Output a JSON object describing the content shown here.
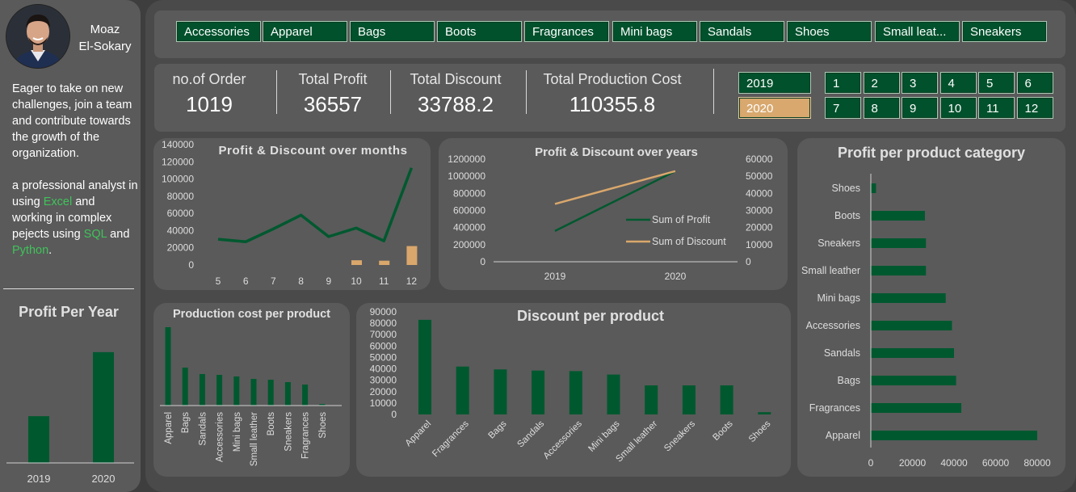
{
  "profile": {
    "name_line1": "Moaz",
    "name_line2": "El-Sokary",
    "about_1": "Eager to take on new challenges, join a team and contribute towards the growth of the organization.",
    "about_2a": "a professional analyst in using ",
    "about_2b": "Excel",
    "about_2c": " and working in complex pejects using ",
    "about_2d": "SQL",
    "about_2e": " and ",
    "about_2f": "Python",
    "about_2g": "."
  },
  "category_slicer": [
    "Accessories",
    "Apparel",
    "Bags",
    "Boots",
    "Fragrances",
    "Mini bags",
    "Sandals",
    "Shoes",
    "Small leat...",
    "Sneakers"
  ],
  "kpis": [
    {
      "label": "no.of Order",
      "value": "1019"
    },
    {
      "label": "Total Profit",
      "value": "36557"
    },
    {
      "label": "Total Discount",
      "value": "33788.2"
    },
    {
      "label": "Total Production Cost",
      "value": "110355.8"
    }
  ],
  "year_slicer": {
    "items": [
      "2019",
      "2020"
    ],
    "selected": "2020"
  },
  "month_slicer": [
    "1",
    "2",
    "3",
    "4",
    "5",
    "6",
    "7",
    "8",
    "9",
    "10",
    "11",
    "12"
  ],
  "colors": {
    "green": "#00582f",
    "tan": "#d9a76c",
    "panel": "#5a5a5a"
  },
  "chart_data": [
    {
      "id": "profit_per_year",
      "type": "bar",
      "title": "Profit Per Year",
      "categories": [
        "2019",
        "2020"
      ],
      "values": [
        27000,
        64000
      ],
      "ylim": [
        0,
        70000
      ],
      "grid": false
    },
    {
      "id": "profit_discount_months",
      "type": "bar",
      "title": "Profit & Discount over months",
      "categories": [
        "5",
        "6",
        "7",
        "8",
        "9",
        "10",
        "11",
        "12"
      ],
      "y_ticks": [
        "0",
        "20000",
        "40000",
        "60000",
        "80000",
        "100000",
        "120000",
        "140000"
      ],
      "ylim": [
        0,
        140000
      ],
      "series": [
        {
          "values": [
            30000,
            27000,
            42000,
            58000,
            33000,
            43000,
            28000,
            113000
          ],
          "chart": "line",
          "color": "#00582f"
        },
        {
          "values": [
            0,
            0,
            0,
            0,
            0,
            5500,
            5000,
            22000
          ],
          "chart": "bar",
          "color": "#d9a76c"
        }
      ]
    },
    {
      "id": "profit_discount_years",
      "type": "line",
      "title": "Profit & Discount over years",
      "categories": [
        "2019",
        "2020"
      ],
      "y_ticks_left": [
        "0",
        "200000",
        "400000",
        "600000",
        "800000",
        "1000000",
        "1200000"
      ],
      "y_ticks_right": [
        "0",
        "10000",
        "20000",
        "30000",
        "40000",
        "50000",
        "60000"
      ],
      "ylim_left": [
        0,
        1200000
      ],
      "ylim_right": [
        0,
        60000
      ],
      "legend": "right",
      "series": [
        {
          "name": "Sum of Profit",
          "values": [
            360000,
            1060000
          ],
          "axis": "left",
          "color": "#00582f"
        },
        {
          "name": "Sum of Discount",
          "values": [
            33800,
            53000
          ],
          "axis": "right",
          "color": "#d9a76c"
        }
      ]
    },
    {
      "id": "production_cost_per_product",
      "type": "bar",
      "title": "Production cost per product",
      "categories": [
        "Apparel",
        "Bags",
        "Sandals",
        "Accessories",
        "Mini bags",
        "Small leather",
        "Boots",
        "Sneakers",
        "Fragrances",
        "Shoes"
      ],
      "values": [
        97000,
        47000,
        39000,
        38000,
        36000,
        33000,
        32000,
        29000,
        26000,
        2000
      ],
      "ylim": [
        0,
        100000
      ]
    },
    {
      "id": "discount_per_product",
      "type": "bar",
      "title": "Discount per product",
      "categories": [
        "Apparel",
        "Fragrances",
        "Bags",
        "Sandals",
        "Accessories",
        "Mini bags",
        "Small leather",
        "Sneakers",
        "Boots",
        "Shoes"
      ],
      "values": [
        83000,
        42000,
        39500,
        38500,
        38000,
        35000,
        25500,
        25500,
        25500,
        2000
      ],
      "y_ticks": [
        "0",
        "10000",
        "20000",
        "30000",
        "40000",
        "50000",
        "60000",
        "70000",
        "80000",
        "90000"
      ],
      "ylim": [
        0,
        90000
      ]
    },
    {
      "id": "profit_per_product_category",
      "type": "bar",
      "orientation": "horizontal",
      "title": "Profit per product category",
      "categories": [
        "Shoes",
        "Boots",
        "Sneakers",
        "Small leather",
        "Mini bags",
        "Accessories",
        "Sandals",
        "Bags",
        "Fragrances",
        "Apparel"
      ],
      "values": [
        2500,
        26000,
        26500,
        26500,
        36000,
        39000,
        40000,
        41000,
        43500,
        80000
      ],
      "x_ticks": [
        "0",
        "20000",
        "40000",
        "60000",
        "80000"
      ],
      "xlim": [
        0,
        80000
      ]
    }
  ]
}
